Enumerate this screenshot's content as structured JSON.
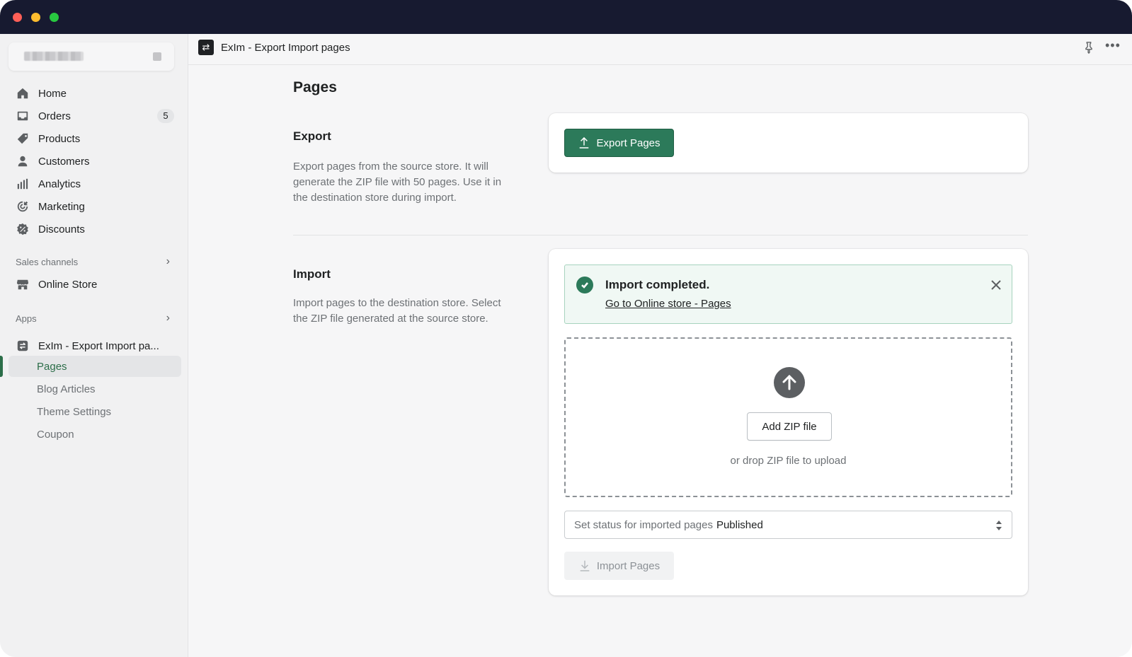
{
  "window": {
    "title_bar_color": "#171a30"
  },
  "app": {
    "title": "ExIm - Export Import pages",
    "logo_glyph": "⇄",
    "icons": {
      "pin": "pin-icon",
      "more": "more-horizontal-icon"
    }
  },
  "sidebar": {
    "nav": [
      {
        "label": "Home",
        "icon": "home-icon"
      },
      {
        "label": "Orders",
        "icon": "orders-icon",
        "badge": "5"
      },
      {
        "label": "Products",
        "icon": "tag-icon"
      },
      {
        "label": "Customers",
        "icon": "person-icon"
      },
      {
        "label": "Analytics",
        "icon": "bar-chart-icon"
      },
      {
        "label": "Marketing",
        "icon": "target-icon"
      },
      {
        "label": "Discounts",
        "icon": "discount-icon"
      }
    ],
    "sales_channels": {
      "label": "Sales channels",
      "items": [
        {
          "label": "Online Store",
          "icon": "store-icon"
        }
      ]
    },
    "apps": {
      "label": "Apps",
      "app_label": "ExIm - Export Import pa...",
      "sub_items": [
        {
          "label": "Pages",
          "active": true
        },
        {
          "label": "Blog Articles"
        },
        {
          "label": "Theme Settings"
        },
        {
          "label": "Coupon"
        }
      ]
    }
  },
  "main": {
    "page_title": "Pages",
    "export": {
      "title": "Export",
      "description": "Export pages from the source store. It will generate the ZIP file with 50 pages. Use it in the destination store during import.",
      "button_label": "Export Pages"
    },
    "import": {
      "title": "Import",
      "description": "Import pages to the destination store. Select the ZIP file generated at the source store.",
      "banner": {
        "title": "Import completed.",
        "link": "Go to Online store - Pages"
      },
      "dropzone": {
        "button_label": "Add ZIP file",
        "hint": "or drop ZIP file to upload"
      },
      "status_select": {
        "label": "Set status for imported pages",
        "value": "Published"
      },
      "button_label": "Import Pages"
    }
  },
  "colors": {
    "primary": "#2c7a5a",
    "success_bg": "#f0f8f4",
    "active_nav": "#2c6e49"
  }
}
